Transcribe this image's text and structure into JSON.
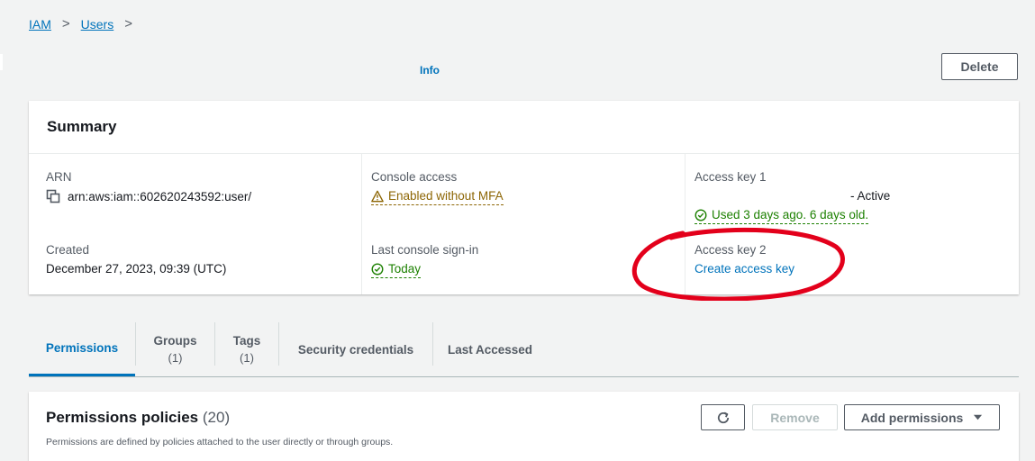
{
  "breadcrumb": {
    "items": [
      "IAM",
      "Users"
    ],
    "separator": ">"
  },
  "header": {
    "info_label": "Info",
    "delete_label": "Delete"
  },
  "summary": {
    "title": "Summary",
    "arn": {
      "label": "ARN",
      "value": "arn:aws:iam::602620243592:user/",
      "icon": "copy-icon"
    },
    "created": {
      "label": "Created",
      "value": "December 27, 2023, 09:39 (UTC)"
    },
    "console_access": {
      "label": "Console access",
      "value": "Enabled without MFA",
      "icon": "warning-icon"
    },
    "last_signin": {
      "label": "Last console sign-in",
      "value": "Today",
      "icon": "check-circle-icon"
    },
    "access_key_1": {
      "label": "Access key 1",
      "status": "- Active",
      "usage": "Used 3 days ago. 6 days old.",
      "icon": "check-circle-icon"
    },
    "access_key_2": {
      "label": "Access key 2",
      "action": "Create access key"
    }
  },
  "tabs": [
    {
      "label": "Permissions",
      "count": ""
    },
    {
      "label": "Groups",
      "count": "(1)"
    },
    {
      "label": "Tags",
      "count": "(1)"
    },
    {
      "label": "Security credentials",
      "count": ""
    },
    {
      "label": "Last Accessed",
      "count": ""
    }
  ],
  "policies": {
    "title": "Permissions policies",
    "count": "(20)",
    "description": "Permissions are defined by policies attached to the user directly or through groups.",
    "refresh_icon": "refresh-icon",
    "remove_label": "Remove",
    "add_label": "Add permissions",
    "add_icon": "caret-down-icon"
  },
  "colors": {
    "link": "#0073bb",
    "warning": "#8d6605",
    "success": "#1d8102",
    "annotation": "#e3001b"
  }
}
